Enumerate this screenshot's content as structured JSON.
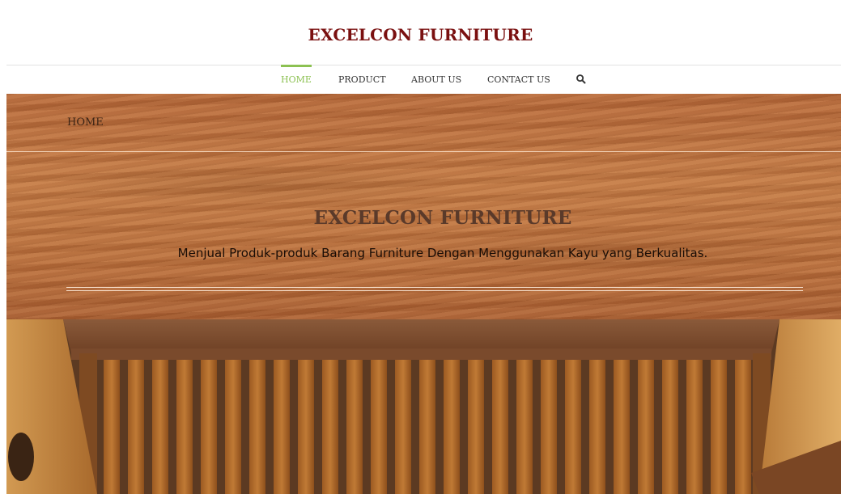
{
  "header": {
    "site_title": "EXCELCON FURNITURE"
  },
  "nav": {
    "items": [
      {
        "label": "HOME",
        "active": true
      },
      {
        "label": "PRODUCT",
        "active": false
      },
      {
        "label": "ABOUT US",
        "active": false
      },
      {
        "label": "CONTACT US",
        "active": false
      }
    ],
    "search_icon": "search-icon",
    "active_color": "#8cc152"
  },
  "hero": {
    "breadcrumb": "HOME",
    "title": "EXCELCON FURNITURE",
    "tagline": "Menjual Produk-produk Barang Furniture Dengan Menggunakan Kayu yang Berkualitas."
  },
  "colors": {
    "brand": "#7a1010",
    "wood": "#b86e38"
  }
}
